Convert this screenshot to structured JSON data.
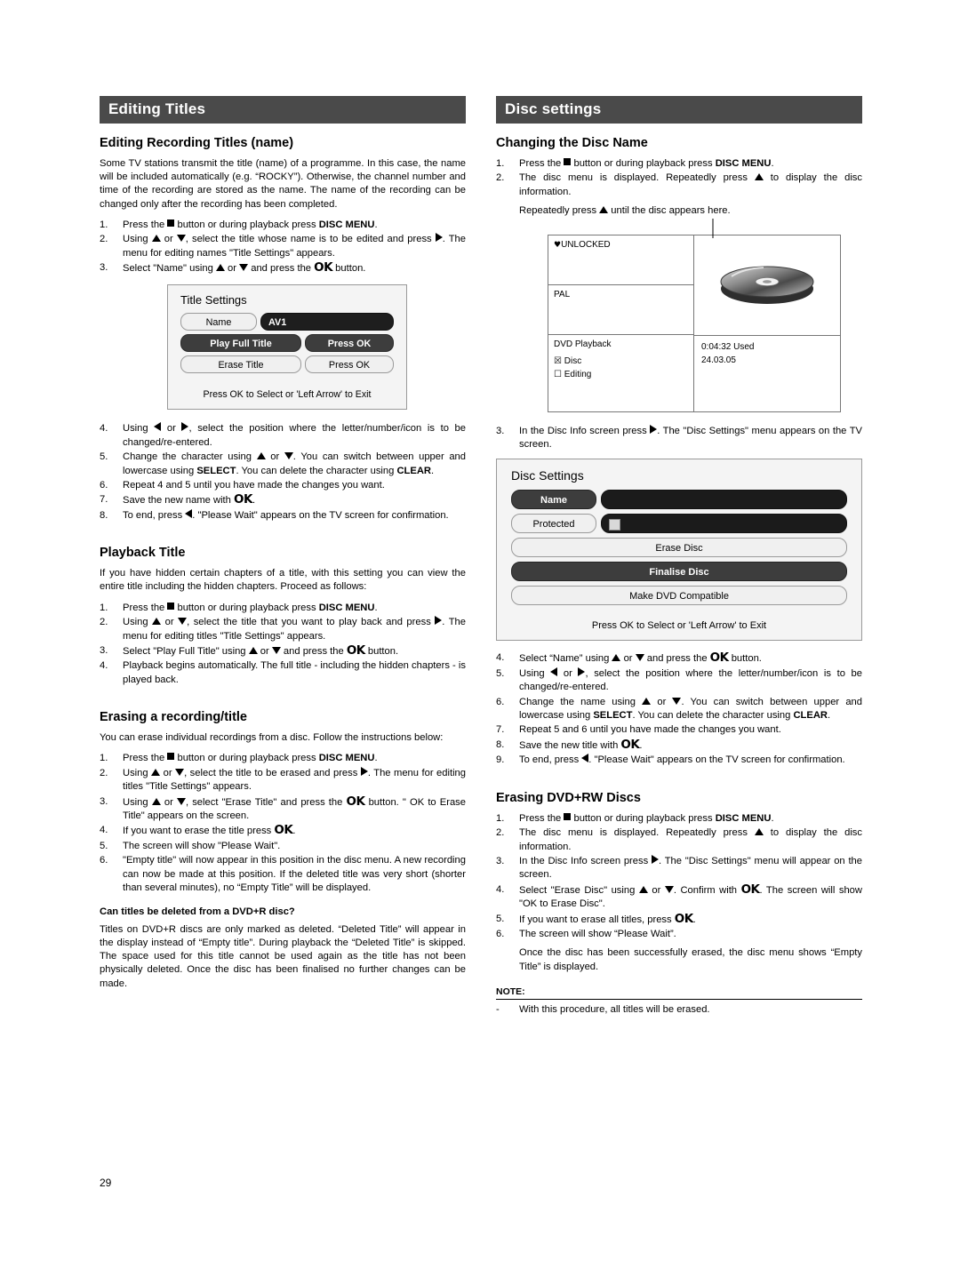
{
  "page": {
    "number": "29"
  },
  "left": {
    "header": "Editing Titles",
    "s1": {
      "title": "Editing Recording Titles (name)",
      "intro": "Some TV stations transmit the title (name) of a programme. In this case, the name will be included automatically (e.g. “ROCKY”). Otherwise, the channel number and time of the recording are stored as the name. The name of the recording can be changed only after the recording has been completed.",
      "steps": [
        "Press the ■ button or during playback press DISC MENU.",
        "Using ▲ or ▼, select the title whose name is to be edited and press ►. The menu for editing names \"Title Settings\" appears.",
        "Select \"Name\" using ▲ or ▼ and press the OK button."
      ],
      "osd": {
        "title": "Title Settings",
        "rows": [
          {
            "label": "Name",
            "value": "AV1"
          },
          {
            "label": "Play Full Title",
            "value": "Press OK"
          },
          {
            "label": "Erase Title",
            "value": "Press OK"
          }
        ],
        "footer": "Press OK to Select or 'Left Arrow' to Exit"
      },
      "steps2": [
        "Using ◄ or ►, select the position where the letter/number/icon is to be changed/re-entered.",
        "Change the character using ▲ or ▼. You can switch between upper and lowercase using SELECT. You can delete the character using CLEAR.",
        "Repeat 4 and 5 until you have made the changes you want.",
        "Save the new name with OK.",
        "To end, press ◄. \"Please Wait\" appears on the TV screen for confirmation."
      ]
    },
    "s2": {
      "title": "Playback Title",
      "intro": "If you have hidden certain chapters of a title, with this setting you can view the entire title including the hidden chapters. Proceed as follows:",
      "steps": [
        "Press the ■ button or during playback press DISC MENU.",
        "Using ▲ or ▼, select the title that you want to play back and press ►. The menu for editing titles \"Title Settings\" appears.",
        "Select \"Play Full Title\" using ▲ or ▼ and press the OK button.",
        "Playback begins automatically. The full title - including the hidden chapters - is played back."
      ]
    },
    "s3": {
      "title": "Erasing a recording/title",
      "intro": "You can erase individual recordings from a disc. Follow the instructions below:",
      "steps": [
        "Press the ■ button or during playback press DISC MENU.",
        "Using ▲ or ▼, select the title to be erased and press ►. The menu for editing titles \"Title Settings\" appears.",
        "Using ▲ or ▼, select \"Erase Title\" and press the OK button. \" OK to Erase Title\" appears on the screen.",
        "If you want to erase the title press OK.",
        "The screen will show \"Please Wait\".",
        "\"Empty title\" will now appear in this position in the disc menu. A new recording can now be made at this position. If the deleted title was very short (shorter than several minutes), no “Empty Title” will be displayed."
      ],
      "q_title": "Can titles be deleted from a DVD+R disc?",
      "q_body": "Titles on DVD+R discs are only marked as deleted. “Deleted Title” will appear in the display instead of “Empty title”. During playback the “Deleted Title” is skipped. The space used for this title cannot be used again as the title has not been physically deleted. Once the disc has been finalised no further changes can be made."
    }
  },
  "right": {
    "header": "Disc settings",
    "s1": {
      "title": "Changing the Disc Name",
      "steps": [
        "Press the ■ button or during playback press DISC MENU.",
        "The disc menu is displayed. Repeatedly press ▲ to display the disc information."
      ],
      "callout": "Repeatedly press ▲ until the disc appears here.",
      "discinfo": {
        "unlocked": "UNLOCKED",
        "pal": "PAL",
        "playback": "DVD Playback",
        "opt_disc": "Disc",
        "opt_editing": "Editing",
        "used": "0:04:32 Used",
        "date": "24.03.05"
      },
      "step3": "In the Disc Info screen press ►. The \"Disc Settings\" menu appears on the TV screen.",
      "osd": {
        "title": "Disc Settings",
        "rows": [
          {
            "label": "Name",
            "value": ""
          },
          {
            "label": "Protected",
            "value": ""
          },
          {
            "label": "Erase Disc",
            "value": ""
          },
          {
            "label": "Finalise Disc",
            "value": ""
          },
          {
            "label": "Make DVD Compatible",
            "value": ""
          }
        ],
        "footer": "Press OK to Select or 'Left Arrow' to Exit"
      },
      "steps2": [
        "Select “Name” using ▲ or ▼ and press the OK button.",
        "Using ◄ or ►, select the position where the letter/number/icon is to be changed/re-entered.",
        "Change the name using ▲ or ▼. You can switch between upper and lowercase using SELECT. You can delete the character using CLEAR.",
        "Repeat 5 and 6 until you have made the changes you want.",
        "Save the new title with OK.",
        "To end, press ◄. \"Please Wait\" appears on the TV screen for confirmation."
      ]
    },
    "s2": {
      "title": "Erasing DVD+RW Discs",
      "steps": [
        "Press the ■ button or during playback press DISC MENU.",
        "The disc menu is displayed. Repeatedly press ▲ to display the disc information.",
        "In the Disc Info screen press ►. The \"Disc Settings\" menu will appear on the screen.",
        "Select \"Erase Disc\" using ▲ or ▼. Confirm with OK. The screen will show \"OK to Erase Disc\".",
        "If you want to erase all titles, press OK.",
        "The screen will show “Please Wait”."
      ],
      "after": "Once the disc has been successfully erased, the disc menu shows “Empty Title” is displayed.",
      "note_label": "NOTE:",
      "note_text": "With this procedure, all titles will be erased.",
      "note_dash": "-"
    }
  }
}
